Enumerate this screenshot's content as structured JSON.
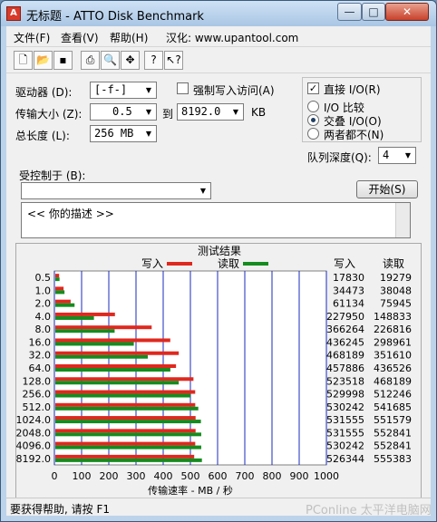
{
  "window": {
    "title": "无标题 - ATTO Disk Benchmark",
    "minimize_glyph": "—",
    "maximize_glyph": "□",
    "close_glyph": "✕"
  },
  "menu": {
    "file": "文件(F)",
    "view": "查看(V)",
    "help": "帮助(H)",
    "localized": "汉化: www.upantool.com"
  },
  "toolbar": {
    "icons": [
      "new-file-icon",
      "open-folder-icon",
      "save-icon",
      "print-icon",
      "print-preview-icon",
      "move-icon",
      "help-icon",
      "context-help-icon"
    ]
  },
  "settings": {
    "drive_label": "驱动器 (D):",
    "drive_value": "[-f-]",
    "force_write_label": "强制写入访问(A)",
    "transfer_label": "传输大小 (Z):",
    "transfer_from": "0.5",
    "to_label": "到",
    "transfer_to": "8192.0",
    "kb_unit": "KB",
    "length_label": "总长度 (L):",
    "length_value": "256 MB",
    "direct_io_label": "直接 I/O(R)",
    "direct_io_checked": true,
    "io_compare": "I/O 比较",
    "overlap_io": "交叠 I/O(O)",
    "neither": "两者都不(N)",
    "selected_mode": "overlap_io",
    "queue_label": "队列深度(Q):",
    "queue_value": "4",
    "controlled_label": "受控制于 (B):",
    "controlled_value": "",
    "start_button": "开始(S)",
    "description": "<<  你的描述  >>"
  },
  "results": {
    "title": "测试结果",
    "write_legend": "写入",
    "read_legend": "读取",
    "write_color": "#e0281e",
    "read_color": "#148c1e",
    "col_write": "写入",
    "col_read": "读取",
    "axis_title": "传输速率 - MB / 秒"
  },
  "chart_data": {
    "type": "bar",
    "orientation": "horizontal",
    "xlabel": "传输速率 - MB / 秒",
    "xlim": [
      0,
      1000
    ],
    "xticks": [
      0,
      100,
      200,
      300,
      400,
      500,
      600,
      700,
      800,
      900,
      1000
    ],
    "categories": [
      "0.5",
      "1.0",
      "2.0",
      "4.0",
      "8.0",
      "16.0",
      "32.0",
      "64.0",
      "128.0",
      "256.0",
      "512.0",
      "1024.0",
      "2048.0",
      "4096.0",
      "8192.0"
    ],
    "series": [
      {
        "name": "写入",
        "values": [
          17830,
          34473,
          61134,
          227950,
          366264,
          436245,
          468189,
          457886,
          523518,
          529998,
          530242,
          531555,
          531555,
          530242,
          526344
        ]
      },
      {
        "name": "读取",
        "values": [
          19279,
          38048,
          75945,
          148833,
          226816,
          298961,
          351610,
          436526,
          468189,
          512246,
          541685,
          551579,
          552841,
          552841,
          555383
        ]
      }
    ]
  },
  "status": {
    "text": "要获得帮助, 请按 F1",
    "watermark": "PConline 太平洋电脑网"
  }
}
